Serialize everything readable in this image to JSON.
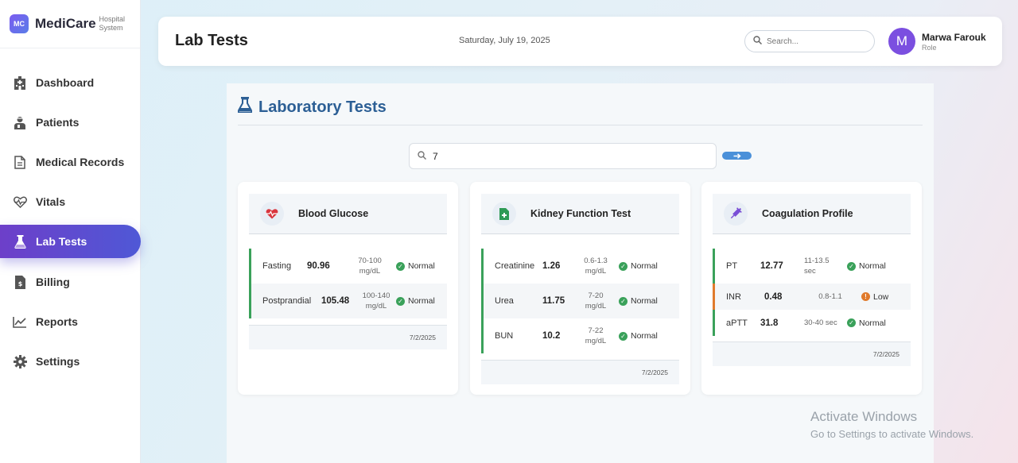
{
  "brand": {
    "badge": "MC",
    "name": "MediCare",
    "sub": "Hospital System"
  },
  "nav": [
    {
      "label": "Dashboard",
      "icon": "hospital-icon"
    },
    {
      "label": "Patients",
      "icon": "user-injured-icon"
    },
    {
      "label": "Medical Records",
      "icon": "file-medical-icon"
    },
    {
      "label": "Vitals",
      "icon": "heartbeat-icon"
    },
    {
      "label": "Lab Tests",
      "icon": "flask-icon",
      "active": true
    },
    {
      "label": "Billing",
      "icon": "invoice-icon"
    },
    {
      "label": "Reports",
      "icon": "chart-line-icon"
    },
    {
      "label": "Settings",
      "icon": "gear-icon"
    }
  ],
  "header": {
    "title": "Lab Tests",
    "date": "Saturday, July 19, 2025",
    "search_placeholder": "Search...",
    "avatar_letter": "M",
    "user_name": "Marwa Farouk",
    "user_role": "Role"
  },
  "panel": {
    "title": "Laboratory Tests",
    "search_value": "7"
  },
  "cards": [
    {
      "title": "Blood Glucose",
      "icon": "heart-pulse-icon",
      "rows": [
        {
          "name": "Fasting",
          "value": "90.96",
          "range": "70-100 mg/dL",
          "status": "Normal"
        },
        {
          "name": "Postprandial",
          "value": "105.48",
          "range": "100-140 mg/dL",
          "status": "Normal"
        }
      ],
      "date": "7/2/2025"
    },
    {
      "title": "Kidney Function Test",
      "icon": "file-medical-icon",
      "rows": [
        {
          "name": "Creatinine",
          "value": "1.26",
          "range": "0.6-1.3 mg/dL",
          "status": "Normal"
        },
        {
          "name": "Urea",
          "value": "11.75",
          "range": "7-20 mg/dL",
          "status": "Normal"
        },
        {
          "name": "BUN",
          "value": "10.2",
          "range": "7-22 mg/dL",
          "status": "Normal"
        }
      ],
      "date": "7/2/2025"
    },
    {
      "title": "Coagulation Profile",
      "icon": "syringe-icon",
      "rows": [
        {
          "name": "PT",
          "value": "12.77",
          "range": "11-13.5 sec",
          "status": "Normal"
        },
        {
          "name": "INR",
          "value": "0.48",
          "range": "0.8-1.1",
          "status": "Low"
        },
        {
          "name": "aPTT",
          "value": "31.8",
          "range": "30-40 sec",
          "status": "Normal"
        }
      ],
      "date": "7/2/2025"
    }
  ],
  "watermark": {
    "line1": "Activate Windows",
    "line2": "Go to Settings to activate Windows."
  },
  "colors": {
    "accent": "#2c5f95",
    "normal": "#3aa15a",
    "low": "#e07a2c",
    "nav_active": "#5a4cd0"
  }
}
